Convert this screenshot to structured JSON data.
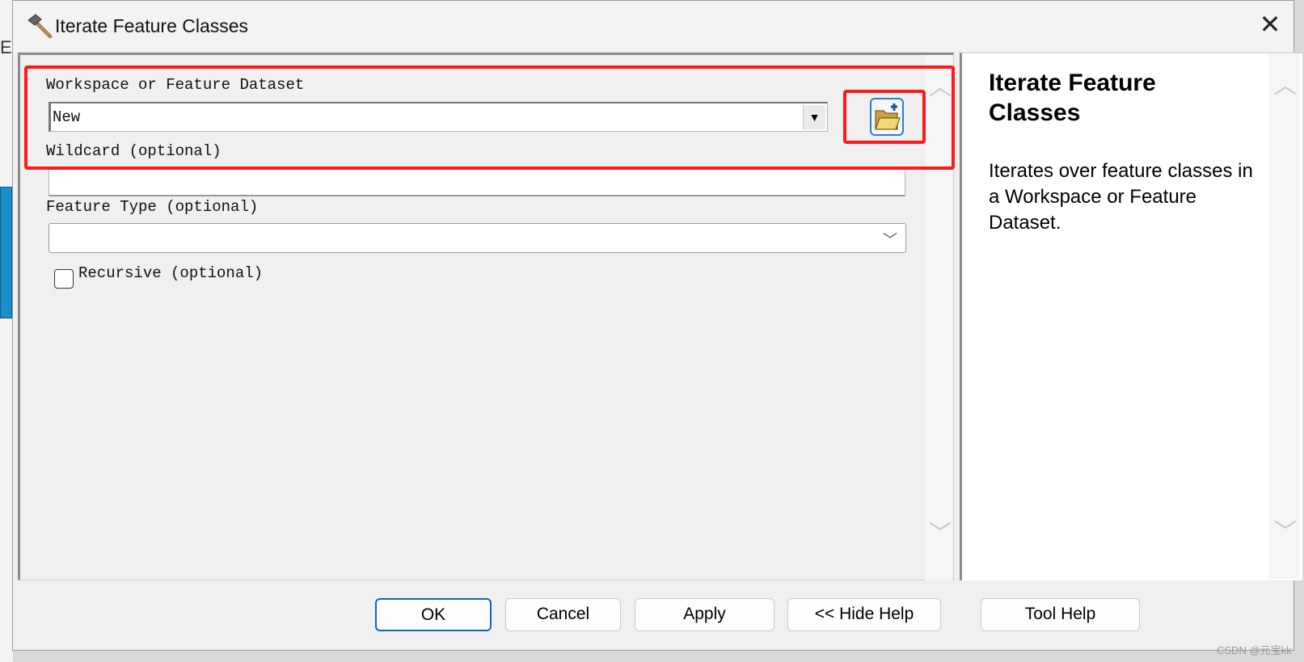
{
  "window": {
    "title": "Iterate Feature Classes",
    "background_text": "Ec"
  },
  "form": {
    "workspace": {
      "label": "Workspace or Feature Dataset",
      "value": "New"
    },
    "wildcard": {
      "label": "Wildcard (optional)",
      "value": ""
    },
    "feature_type": {
      "label": "Feature Type (optional)",
      "value": ""
    },
    "recursive": {
      "label": "Recursive (optional)",
      "checked": false
    }
  },
  "help": {
    "title": "Iterate Feature Classes",
    "body": "Iterates over feature classes in a Workspace or Feature Dataset."
  },
  "buttons": {
    "ok": "OK",
    "cancel": "Cancel",
    "apply": "Apply",
    "hide_help": "<< Hide Help",
    "tool_help": "Tool Help"
  },
  "watermark": "CSDN @元宝kk",
  "colors": {
    "highlight": "#ff1a1a",
    "focus": "#0a66c2"
  }
}
